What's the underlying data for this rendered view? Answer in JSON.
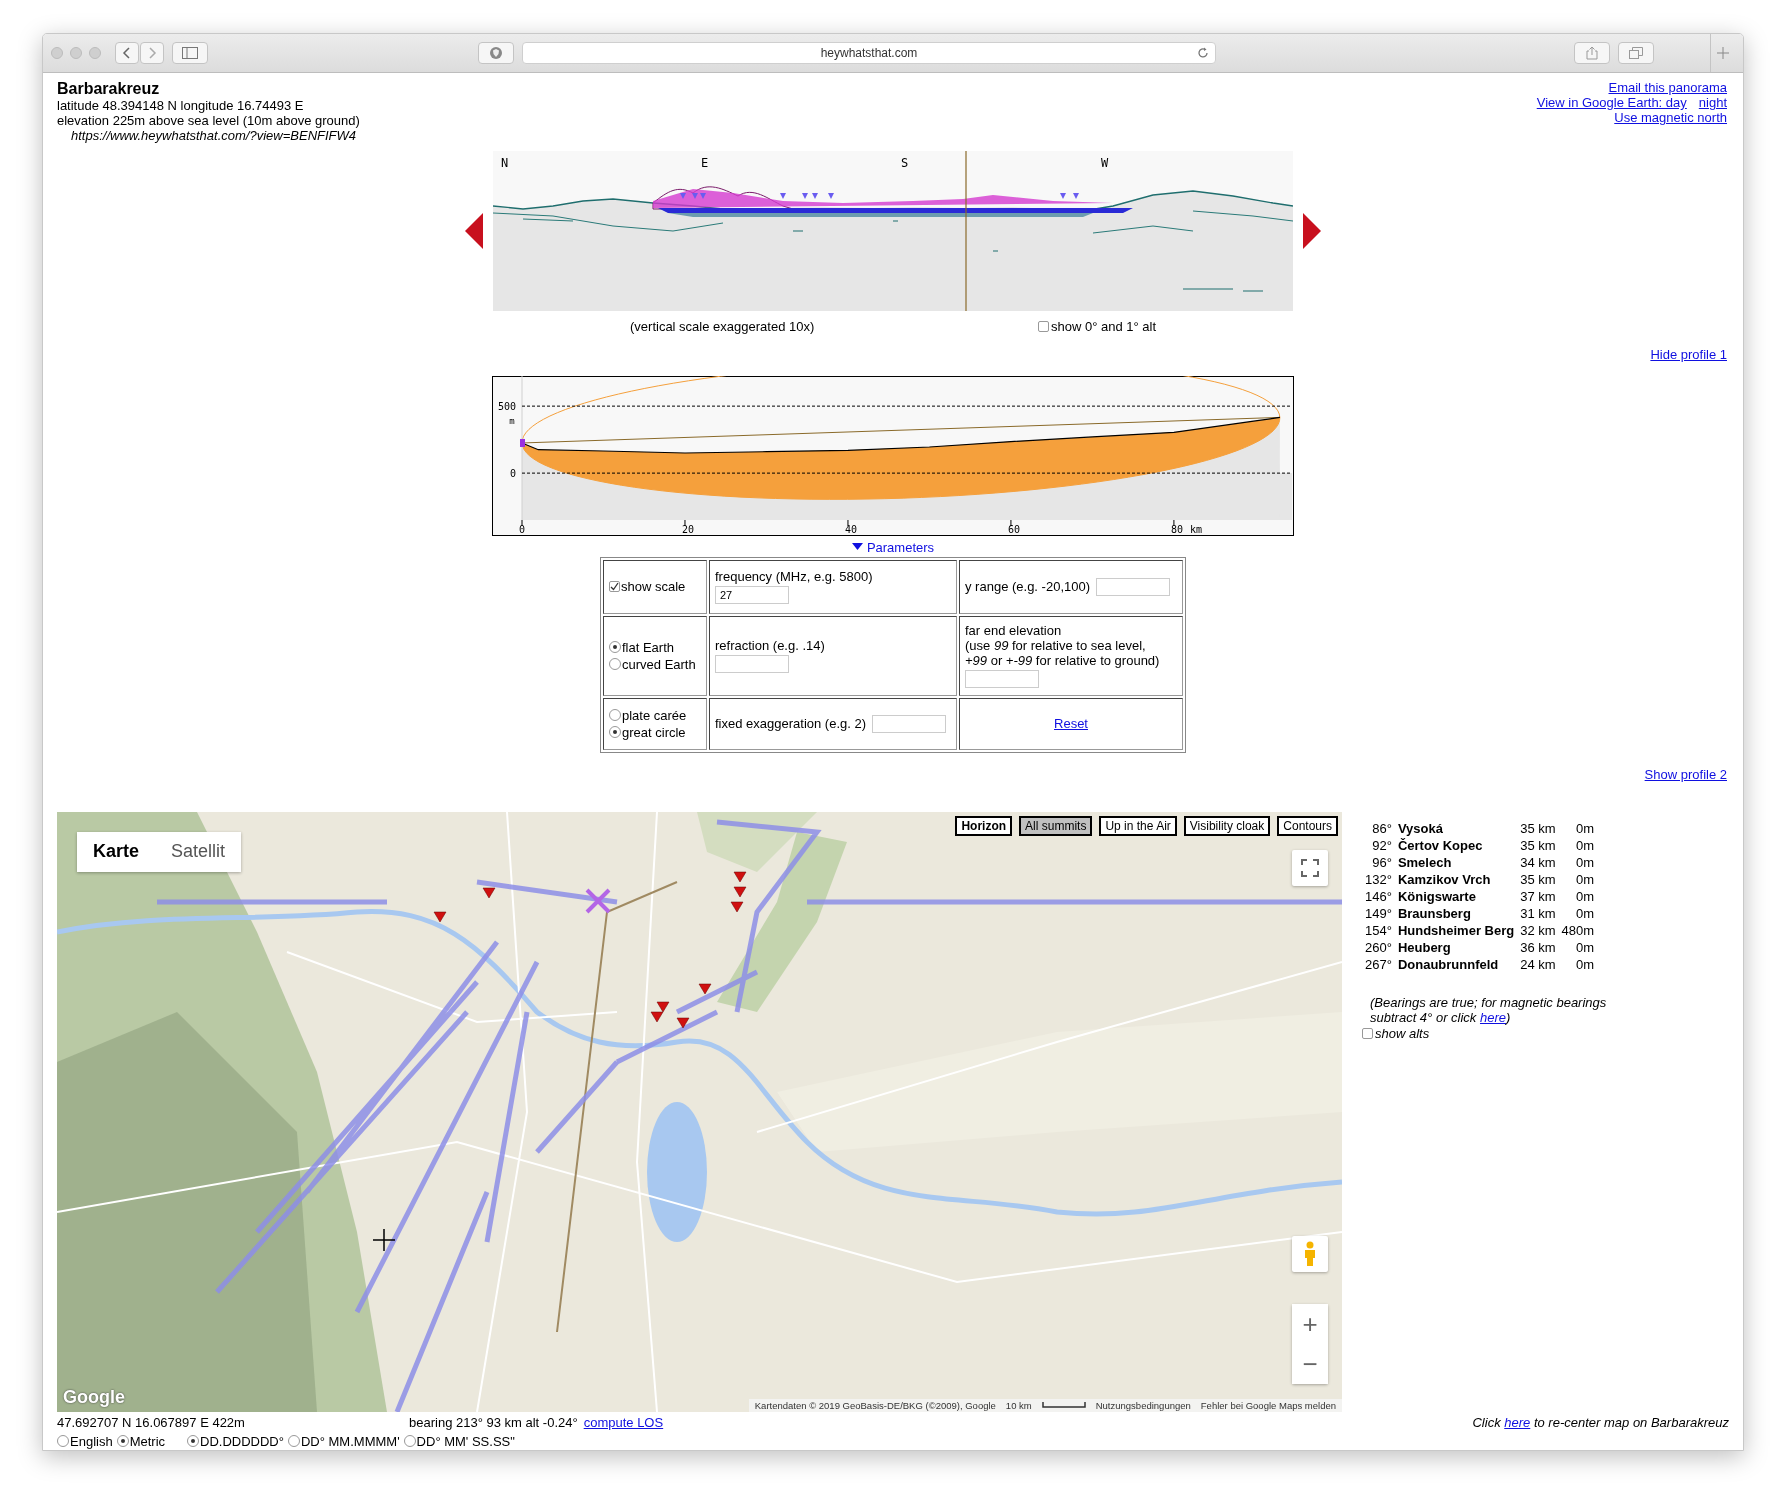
{
  "browser": {
    "address": "heywhatsthat.com"
  },
  "header": {
    "title": "Barbarakreuz",
    "lines": [
      "latitude 48.394148 N longitude 16.74493 E",
      "elevation 225m above sea level (10m above ground)"
    ],
    "url": "https://www.heywhatsthat.com/?view=BENFIFW4",
    "link_rows": [
      [
        "Email this panorama"
      ],
      [
        "View in Google Earth: day",
        "night"
      ],
      [
        "Use magnetic north"
      ]
    ]
  },
  "panorama": {
    "compass": [
      "N",
      "E",
      "S",
      "W"
    ],
    "caption": "(vertical scale exaggerated 10x)",
    "alt_toggle": {
      "label": "show 0° and 1° alt",
      "checked": false
    }
  },
  "hide_profile": "Hide profile 1",
  "profile": {
    "chart_data": {
      "type": "line",
      "xlabel": "km",
      "ylabel": "m",
      "x": [
        0,
        2,
        10,
        20,
        30,
        40,
        50,
        60,
        70,
        80,
        90,
        93
      ],
      "series": [
        {
          "color": "#000000",
          "values": [
            225,
            175,
            165,
            150,
            160,
            170,
            195,
            235,
            270,
            305,
            390,
            416
          ]
        }
      ],
      "xlim": [
        0,
        94
      ],
      "ylim": [
        -350,
        725
      ],
      "xticks": [
        0,
        20,
        40,
        60,
        80
      ],
      "yticks": [
        0,
        500
      ]
    }
  },
  "parameters": {
    "label": "Parameters",
    "expanded": true,
    "rows": [
      {
        "choices": [
          {
            "kind": "checkbox",
            "label": "show scale",
            "checked": true
          }
        ],
        "field": {
          "kind": "stacked",
          "label": "frequency (MHz, e.g. 5800)",
          "value": "27"
        },
        "extra": {
          "kind": "field",
          "lines": [
            "y range (e.g. -20,100)"
          ]
        }
      },
      {
        "choices": [
          {
            "kind": "radio",
            "label": "flat Earth",
            "selected": true
          },
          {
            "kind": "radio",
            "label": "curved Earth",
            "selected": false
          }
        ],
        "field": {
          "kind": "stacked",
          "label": "refraction (e.g. .14)"
        },
        "extra": {
          "kind": "stacked",
          "lines": [
            "far end elevation",
            "(use *99* for relative to sea level,",
            "*+99* or *+-99* for relative to ground)"
          ]
        }
      },
      {
        "choices": [
          {
            "kind": "radio",
            "label": "plate carée",
            "selected": false
          },
          {
            "kind": "radio",
            "label": "great circle",
            "selected": true
          }
        ],
        "field": {
          "kind": "inline",
          "label": "fixed exaggeration (e.g. 2)"
        },
        "extra": {
          "kind": "link",
          "lines": [
            "Reset"
          ]
        }
      }
    ]
  },
  "show_profile": "Show profile 2",
  "map": {
    "map_types": [
      {
        "label": "Karte",
        "selected": true
      },
      {
        "label": "Satellit",
        "selected": false
      }
    ],
    "layers": [
      {
        "label": "Horizon",
        "selected": false,
        "bold": true
      },
      {
        "label": "All summits",
        "selected": true,
        "bold": false
      },
      {
        "label": "Up in the Air",
        "selected": false,
        "bold": false
      },
      {
        "label": "Visibility cloak",
        "selected": false,
        "bold": false
      },
      {
        "label": "Contours",
        "selected": false,
        "bold": false
      }
    ],
    "logo": "Google",
    "attribution": "Kartendaten © 2019 GeoBasis-DE/BKG (©2009), Google",
    "scale": "10 km",
    "terms": "Nutzungsbedingungen",
    "report": "Fehler bei Google Maps melden",
    "zoom_in": "+",
    "zoom_out": "−"
  },
  "summits": {
    "rows": [
      {
        "bearing": "86°",
        "name": "Vysoká",
        "distance": "35 km",
        "height": "0m"
      },
      {
        "bearing": "92°",
        "name": "Čertov Kopec",
        "distance": "35 km",
        "height": "0m"
      },
      {
        "bearing": "96°",
        "name": "Smelech",
        "distance": "34 km",
        "height": "0m"
      },
      {
        "bearing": "132°",
        "name": "Kamzikov Vrch",
        "distance": "35 km",
        "height": "0m"
      },
      {
        "bearing": "146°",
        "name": "Königswarte",
        "distance": "37 km",
        "height": "0m"
      },
      {
        "bearing": "149°",
        "name": "Braunsberg",
        "distance": "31 km",
        "height": "0m"
      },
      {
        "bearing": "154°",
        "name": "Hundsheimer Berg",
        "distance": "32 km",
        "height": "480m"
      },
      {
        "bearing": "260°",
        "name": "Heuberg",
        "distance": "36 km",
        "height": "0m"
      },
      {
        "bearing": "267°",
        "name": "Donaubrunnfeld",
        "distance": "24 km",
        "height": "0m"
      }
    ],
    "note": "(Bearings are true; for magnetic bearings subtract 4° or click",
    "note_link": "here",
    "note_end": ")",
    "show_alts": {
      "label": "show alts",
      "checked": false
    }
  },
  "status": {
    "position": "47.692707 N 16.067897 E 422m",
    "bearing": "bearing 213° 93 km alt -0.24°",
    "los_link": "compute LOS",
    "recenter_start": "Click",
    "recenter_link": "here",
    "recenter_end": "to re-center map on Barbarakreuz"
  },
  "units": [
    {
      "label": "English",
      "selected": false
    },
    {
      "label": "Metric",
      "selected": true
    }
  ],
  "formats": [
    {
      "label": "DD.DDDDDD°",
      "selected": true
    },
    {
      "label": "DD° MM.MMMM'",
      "selected": false
    },
    {
      "label": "DD° MM' SS.SS\"",
      "selected": false
    }
  ]
}
